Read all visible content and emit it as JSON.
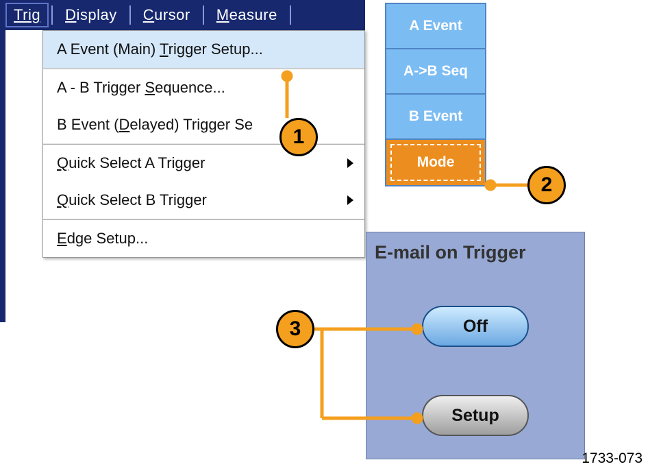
{
  "menubar": {
    "trig": "Trig",
    "display_pre": "D",
    "display_rest": "isplay",
    "cursor_pre": "C",
    "cursor_rest": "ursor",
    "measure_pre": "M",
    "measure_rest": "easure"
  },
  "dropdown": {
    "item1_pre": "A Event (Main) ",
    "item1_u": "T",
    "item1_rest": "rigger Setup...",
    "item2_pre": "A - B Trigger ",
    "item2_u": "S",
    "item2_rest": "equence...",
    "item3_pre": "B Event (",
    "item3_u": "D",
    "item3_rest": "elayed) Trigger Se",
    "item4_u": "Q",
    "item4_rest": "uick Select A Trigger",
    "item5_u": "Q",
    "item5_rest": "uick Select B Trigger",
    "item6_u": "E",
    "item6_rest": "dge Setup..."
  },
  "tabs": {
    "a_event": "A Event",
    "ab_seq": "A->B Seq",
    "b_event": "B Event",
    "mode": "Mode"
  },
  "epanel": {
    "title": "E-mail on Trigger",
    "off": "Off",
    "setup": "Setup"
  },
  "callouts": {
    "one": "1",
    "two": "2",
    "three": "3"
  },
  "figure_label": "1733-073"
}
